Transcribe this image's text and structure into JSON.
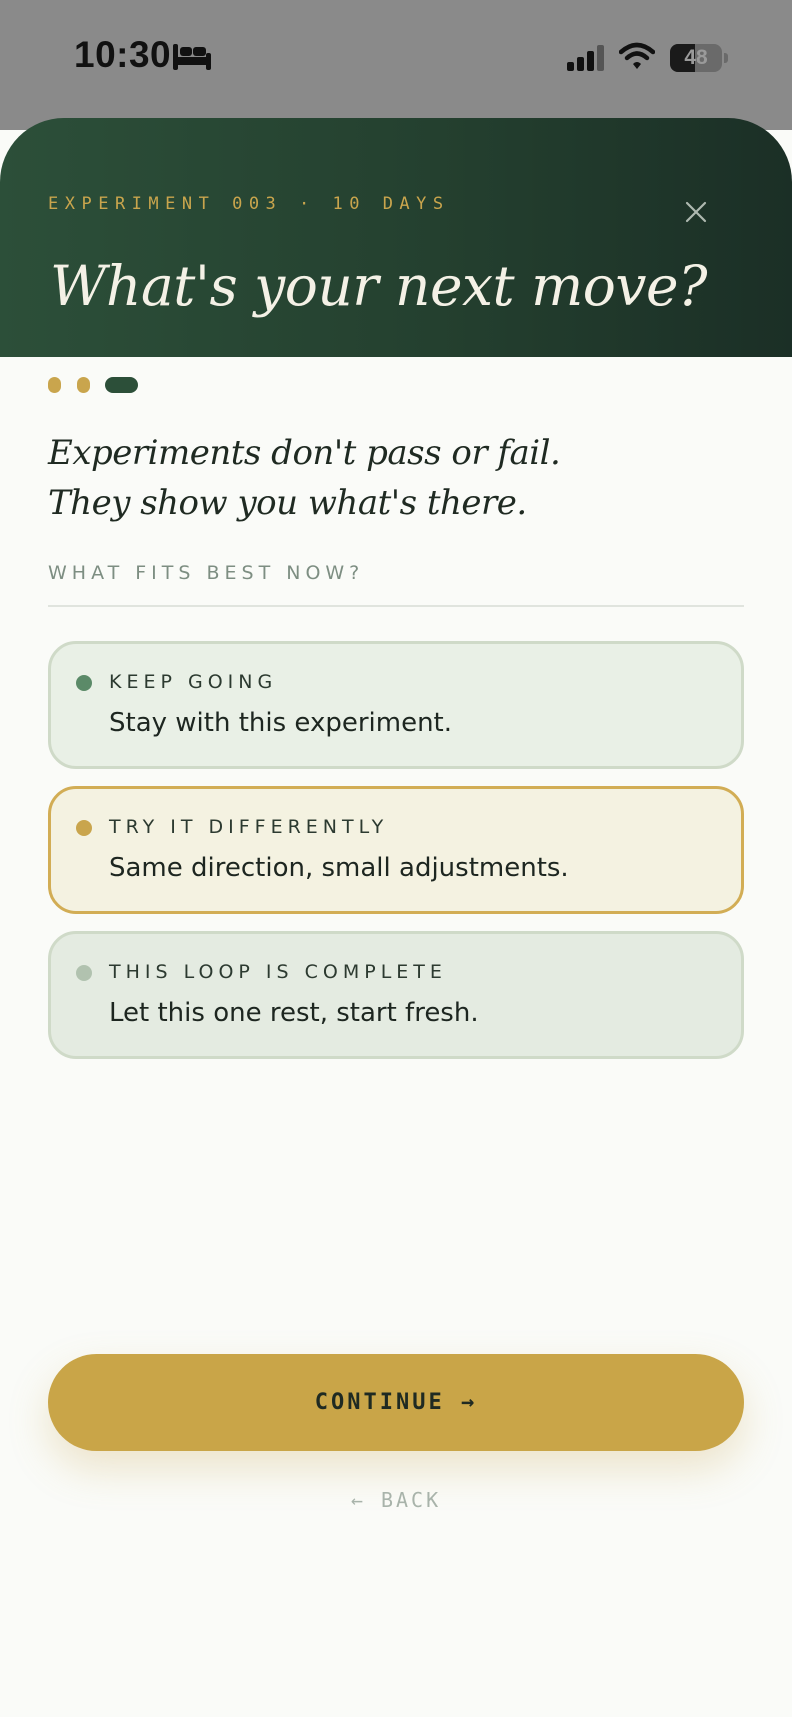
{
  "status_bar": {
    "time": "10:30",
    "battery_level": "48",
    "battery_fraction": 0.48,
    "icons": [
      "bed-icon",
      "signal-icon",
      "wifi-icon",
      "battery-icon"
    ]
  },
  "header": {
    "eyebrow": "EXPERIMENT 003 · 10 DAYS",
    "title": "What's your next move?",
    "close_icon": "close-icon"
  },
  "progress": {
    "total_steps": 3,
    "current_step": 3
  },
  "tagline": {
    "line1": "Experiments don't pass or fail.",
    "line2": "They show you what's there."
  },
  "question": {
    "label": "WHAT FITS BEST NOW?"
  },
  "options": [
    {
      "title": "KEEP GOING",
      "description": "Stay with this experiment.",
      "dot_color": "#5b8a68",
      "selected": false
    },
    {
      "title": "TRY IT DIFFERENTLY",
      "description": "Same direction, small adjustments.",
      "dot_color": "#c9a54d",
      "selected": true
    },
    {
      "title": "THIS LOOP IS COMPLETE",
      "description": "Let this one rest, start fresh.",
      "dot_color": "#b1c2af",
      "selected": false
    }
  ],
  "actions": {
    "continue_label": "CONTINUE →",
    "back_label": "← BACK"
  },
  "colors": {
    "header_bg": "#2c4f39",
    "accent_gold": "#c9a548",
    "page_bg": "#fafbf8"
  }
}
